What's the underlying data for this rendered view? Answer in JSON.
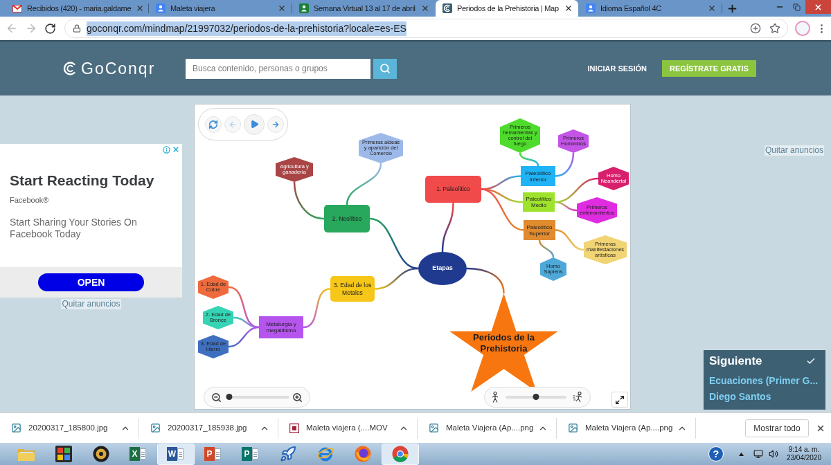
{
  "browser": {
    "tabs": [
      {
        "title": "Recibidos (420) - maria.galdame",
        "selected": false
      },
      {
        "title": "Maleta viajera",
        "selected": false
      },
      {
        "title": "Semana Virtual 13 al 17 de abril",
        "selected": false
      },
      {
        "title": "Periodos de la Prehistoria | Map",
        "selected": true
      },
      {
        "title": "Idioma Español 4C",
        "selected": false
      }
    ],
    "back": {
      "disabled": true
    },
    "forward": {
      "disabled": true
    },
    "url": {
      "text": "goconqr.com/mindmap/21997032/periodos-de-la-prehistoria?locale=es-ES",
      "selected": true
    }
  },
  "site_header": {
    "logo": "GoConqr",
    "search": {
      "placeholder": "Busca contenido, personas o grupos"
    },
    "login": "INICIAR SESIÓN",
    "signup": "REGÍSTRATE GRATIS"
  },
  "ad": {
    "headline": "Start Reacting Today",
    "advertiser": "Facebook®",
    "body": "Start Sharing Your Stories On Facebook Today",
    "button": "OPEN",
    "remove_ads": "Quitar anuncios"
  },
  "mindmap": {
    "playback": {
      "back": {
        "disabled": true
      },
      "forward": {
        "disabled": false
      }
    },
    "zoom": {
      "level": 0.05
    },
    "speed": {
      "level": 0.5
    },
    "root": {
      "text": "Periodos de la Prehistoria",
      "kind": "star",
      "color": "#f7760f",
      "children": [
        {
          "text": "Etapas",
          "kind": "ellipse",
          "color": "#1f3a8f",
          "children": [
            {
              "text": "1. Paleolítico",
              "kind": "rounded",
              "color": "#f04a4a",
              "children": [
                {
                  "text": "Paleolítico Inferior",
                  "kind": "rect",
                  "color": "#1fb3f5",
                  "children": [
                    {
                      "text": "Primeros herramientas y control del fuego",
                      "kind": "hexagon",
                      "color": "#4fdb2c"
                    },
                    {
                      "text": "Primeros Homínidos",
                      "kind": "hexagon",
                      "color": "#c354e6"
                    }
                  ]
                },
                {
                  "text": "Paleolítico Medio",
                  "kind": "rect",
                  "color": "#9ee22c",
                  "children": [
                    {
                      "text": "Homo Neandertal",
                      "kind": "hexagon",
                      "color": "#d81f6c"
                    },
                    {
                      "text": "Primeros enterramientos",
                      "kind": "hexagon",
                      "color": "#e02ce0"
                    }
                  ]
                },
                {
                  "text": "Paleolítico Superior",
                  "kind": "rect",
                  "color": "#e08b2e",
                  "children": [
                    {
                      "text": "Primeras manifestaciones artísticas",
                      "kind": "hexagon",
                      "color": "#f1d474"
                    },
                    {
                      "text": "Homo Sapiens",
                      "kind": "hexagon",
                      "color": "#4ea9d9"
                    }
                  ]
                }
              ]
            },
            {
              "text": "2. Neolítico",
              "kind": "rounded",
              "color": "#27a85c",
              "children": [
                {
                  "text": "Agricultura y ganadería",
                  "kind": "hexagon",
                  "color": "#a94545"
                },
                {
                  "text": "Primeras aldeas y aparición del Comercio",
                  "kind": "hexagon",
                  "color": "#9db9e9"
                }
              ]
            },
            {
              "text": "3. Edad de los Metales",
              "kind": "rounded",
              "color": "#f6c619",
              "children": [
                {
                  "text": "Metalurgia y megalitismo",
                  "kind": "rect",
                  "color": "#b655ee",
                  "children": [
                    {
                      "text": "1. Edad de Cobre",
                      "kind": "hexagon",
                      "color": "#ef6b3d"
                    },
                    {
                      "text": "2. Edad de Bronce",
                      "kind": "hexagon",
                      "color": "#35d4b5"
                    },
                    {
                      "text": "3. Edad de Hierro",
                      "kind": "hexagon",
                      "color": "#3f6fbf"
                    }
                  ]
                }
              ]
            }
          ]
        }
      ]
    }
  },
  "sidebar": {
    "remove_ads": "Quitar anuncios",
    "next": {
      "heading": "Siguiente",
      "title": "Ecuaciones (Primer G...",
      "author": "Diego Santos"
    }
  },
  "downloads": {
    "items": [
      {
        "name": "20200317_185800.jpg",
        "kind": "image"
      },
      {
        "name": "20200317_185938.jpg",
        "kind": "image"
      },
      {
        "name": "Maleta viajera (....MOV",
        "kind": "video"
      },
      {
        "name": "Maleta Viajera (Ap....png",
        "kind": "image"
      },
      {
        "name": "Maleta Viajera (Ap....png",
        "kind": "image"
      }
    ],
    "show_all": "Mostrar todo"
  },
  "taskbar": {
    "apps": [
      {
        "active": false
      },
      {
        "active": false
      },
      {
        "active": false
      },
      {
        "glyph": "X",
        "active": false
      },
      {
        "glyph": "W",
        "active": true
      },
      {
        "glyph": "P",
        "active": false
      },
      {
        "glyph": "P",
        "active": false
      },
      {
        "active": false
      },
      {
        "active": false
      },
      {
        "active": false
      },
      {
        "active": true
      }
    ],
    "tray": {
      "help": "?",
      "time": "9:14 a. m.",
      "date": "23/04/2020"
    }
  }
}
